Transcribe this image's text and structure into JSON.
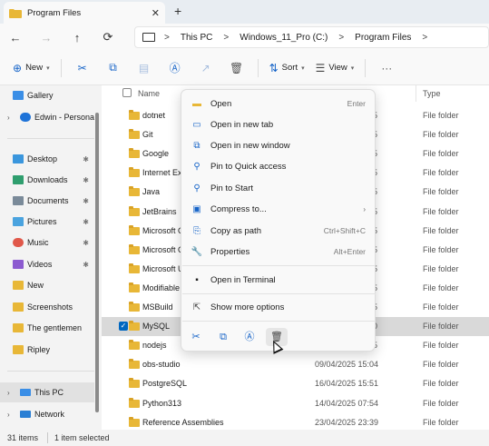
{
  "window": {
    "tab_title": "Program Files",
    "tab_close": "✕",
    "new_tab": "+"
  },
  "nav": {
    "back": "←",
    "forward": "→",
    "up": "↑",
    "refresh": "⟳"
  },
  "address": {
    "crumbs": [
      "This PC",
      "Windows_11_Pro (C:)",
      "Program Files"
    ],
    "sep": ">"
  },
  "toolbar": {
    "new_label": "New",
    "sort_label": "Sort",
    "view_label": "View",
    "more": "···"
  },
  "sidebar": {
    "items": [
      {
        "label": "Gallery",
        "icon": "gallery-icon"
      },
      {
        "label": "Edwin - Personal",
        "icon": "cloud-icon"
      },
      {
        "label": "Desktop",
        "icon": "desktop-icon",
        "pinned": true
      },
      {
        "label": "Downloads",
        "icon": "download-icon",
        "pinned": true
      },
      {
        "label": "Documents",
        "icon": "document-icon",
        "pinned": true
      },
      {
        "label": "Pictures",
        "icon": "pictures-icon",
        "pinned": true
      },
      {
        "label": "Music",
        "icon": "music-icon",
        "pinned": true
      },
      {
        "label": "Videos",
        "icon": "videos-icon",
        "pinned": true
      },
      {
        "label": "New",
        "icon": "folder-icon"
      },
      {
        "label": "Screenshots",
        "icon": "folder-icon"
      },
      {
        "label": "The gentlemen",
        "icon": "folder-icon"
      },
      {
        "label": "Ripley",
        "icon": "folder-icon"
      },
      {
        "label": "This PC",
        "icon": "pc-icon"
      },
      {
        "label": "Network",
        "icon": "network-icon"
      }
    ],
    "pin_glyph": "📌"
  },
  "columns": {
    "name": "Name",
    "type": "Type"
  },
  "files": [
    {
      "name": "dotnet",
      "date": "",
      "date_tail": "5",
      "type": "File folder"
    },
    {
      "name": "Git",
      "date": "",
      "date_tail": "5",
      "type": "File folder"
    },
    {
      "name": "Google",
      "date": "",
      "date_tail": "5",
      "type": "File folder"
    },
    {
      "name": "Internet Ex",
      "date": "",
      "date_tail": "5",
      "type": "File folder"
    },
    {
      "name": "Java",
      "date": "",
      "date_tail": "5",
      "type": "File folder"
    },
    {
      "name": "JetBrains",
      "date": "",
      "date_tail": "5",
      "type": "File folder"
    },
    {
      "name": "Microsoft C",
      "date": "",
      "date_tail": "5",
      "type": "File folder"
    },
    {
      "name": "Microsoft C",
      "date": "",
      "date_tail": "5",
      "type": "File folder"
    },
    {
      "name": "Microsoft U",
      "date": "",
      "date_tail": "5",
      "type": "File folder"
    },
    {
      "name": "Modifiable",
      "date": "",
      "date_tail": "5",
      "type": "File folder"
    },
    {
      "name": "MSBuild",
      "date": "",
      "date_tail": "5",
      "type": "File folder"
    },
    {
      "name": "MySQL",
      "date": "",
      "date_tail": "0",
      "type": "File folder",
      "selected": true
    },
    {
      "name": "nodejs",
      "date": "",
      "date_tail": "5",
      "type": "File folder"
    },
    {
      "name": "obs-studio",
      "date": "09/04/2025 15:04",
      "date_tail": "",
      "type": "File folder"
    },
    {
      "name": "PostgreSQL",
      "date": "16/04/2025 15:51",
      "date_tail": "",
      "type": "File folder"
    },
    {
      "name": "Python313",
      "date": "14/04/2025 07:54",
      "date_tail": "",
      "type": "File folder"
    },
    {
      "name": "Reference Assemblies",
      "date": "23/04/2025 23:39",
      "date_tail": "",
      "type": "File folder"
    }
  ],
  "context_menu": {
    "items": [
      {
        "label": "Open",
        "shortcut": "Enter",
        "icon": "folder-open-icon"
      },
      {
        "label": "Open in new tab",
        "shortcut": "",
        "icon": "new-tab-icon"
      },
      {
        "label": "Open in new window",
        "shortcut": "",
        "icon": "new-window-icon"
      },
      {
        "label": "Pin to Quick access",
        "shortcut": "",
        "icon": "pin-icon"
      },
      {
        "label": "Pin to Start",
        "shortcut": "",
        "icon": "pin-start-icon"
      },
      {
        "label": "Compress to...",
        "shortcut": "",
        "icon": "compress-icon",
        "submenu": "›"
      },
      {
        "label": "Copy as path",
        "shortcut": "Ctrl+Shift+C",
        "icon": "copy-path-icon"
      },
      {
        "label": "Properties",
        "shortcut": "Alt+Enter",
        "icon": "properties-icon"
      },
      {
        "label": "Open in Terminal",
        "shortcut": "",
        "icon": "terminal-icon"
      },
      {
        "label": "Show more options",
        "shortcut": "",
        "icon": "more-options-icon"
      }
    ]
  },
  "status": {
    "items_count": "31 items",
    "selected": "1 item selected"
  },
  "colors": {
    "accent": "#0067c0",
    "folder": "#e8b737",
    "selection": "#d9d9d9"
  }
}
